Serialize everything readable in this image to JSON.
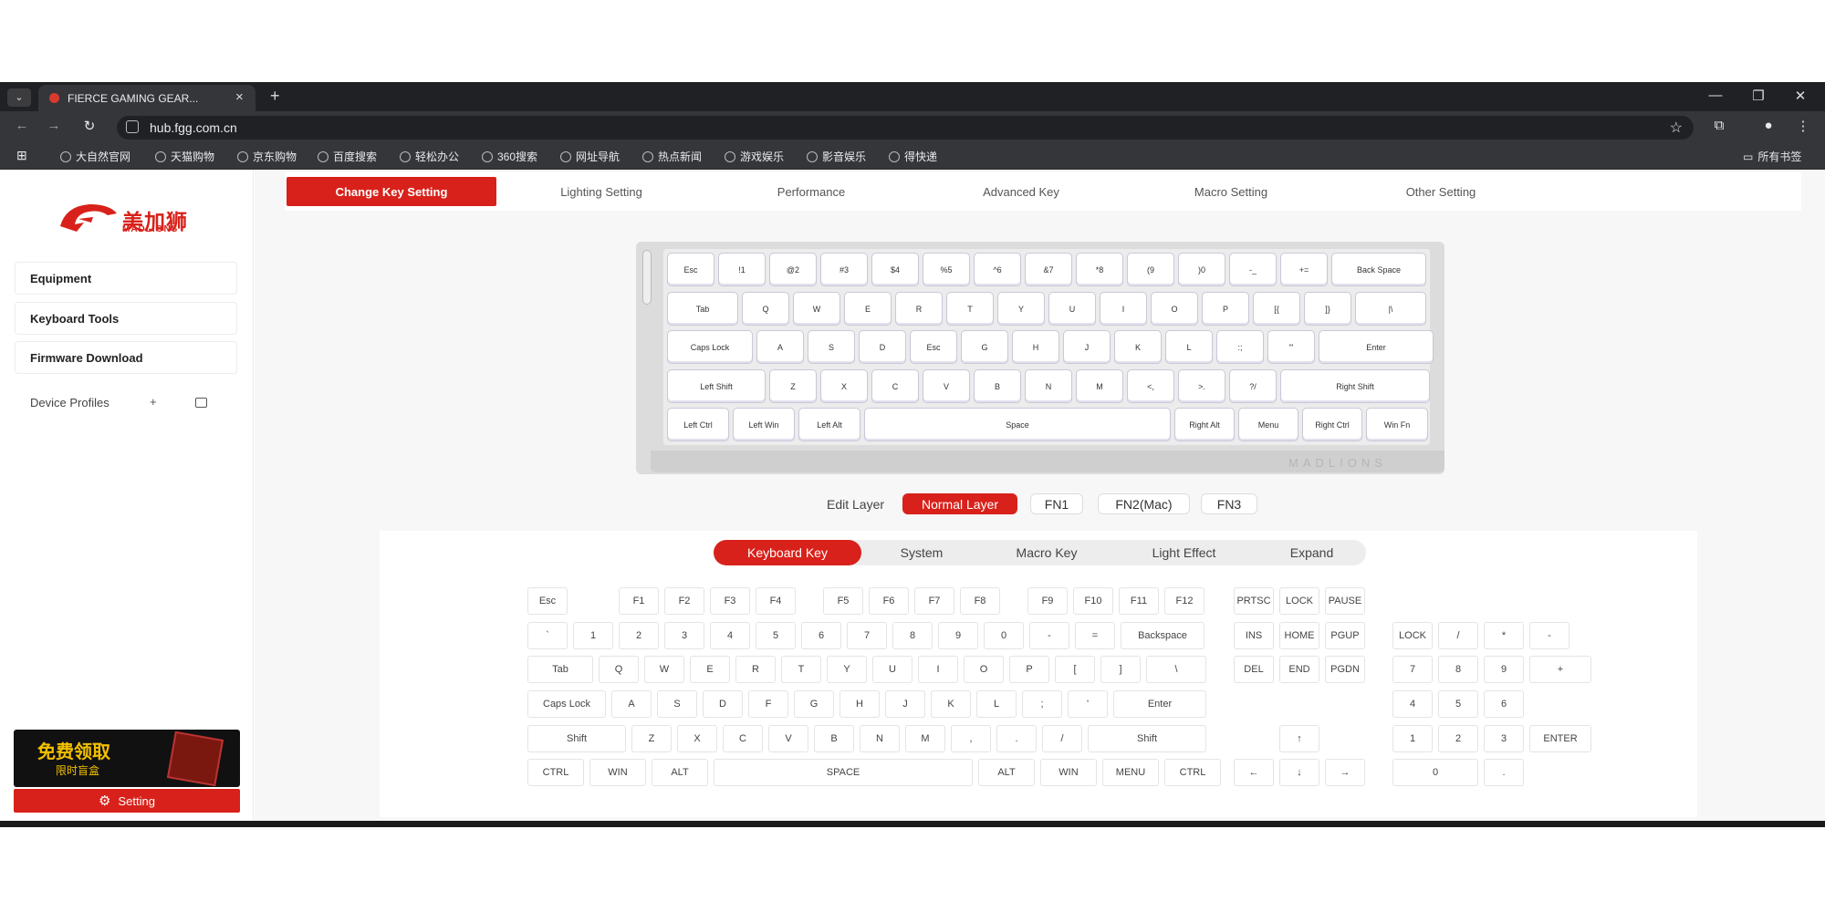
{
  "browser": {
    "tab_title": "FIERCE GAMING GEAR...",
    "url": "hub.fgg.com.cn",
    "bookmarks": [
      "大自然官网",
      "天猫购物",
      "京东购物",
      "百度搜索",
      "轻松办公",
      "360搜索",
      "网址导航",
      "热点新闻",
      "游戏娱乐",
      "影音娱乐",
      "得快递"
    ],
    "bookmark_folder": "所有书签"
  },
  "sidebar": {
    "logo_text": "美加狮",
    "logo_sub": "MADLIONS",
    "items": [
      "Equipment",
      "Keyboard Tools",
      "Firmware Download"
    ],
    "device_profiles": "Device Profiles",
    "plus": "+",
    "banner_line1": "免费领取",
    "banner_line2": "限时盲盒",
    "setting_label": "Setting"
  },
  "top_tabs": [
    "Change Key Setting",
    "Lighting Setting",
    "Performance",
    "Advanced Key",
    "Macro Setting",
    "Other Setting"
  ],
  "keyboard": {
    "brand": "MADLIONS",
    "rows": [
      [
        "Esc",
        "!1",
        "@2",
        "#3",
        "$4",
        "%5",
        "^6",
        "&7",
        "*8",
        "(9",
        ")0",
        "-_",
        "+=",
        "Back Space"
      ],
      [
        "Tab",
        "Q",
        "W",
        "E",
        "R",
        "T",
        "Y",
        "U",
        "I",
        "O",
        "P",
        "[{",
        "]}",
        "|\\"
      ],
      [
        "Caps Lock",
        "A",
        "S",
        "D",
        "Esc",
        "G",
        "H",
        "J",
        "K",
        "L",
        ":;",
        "\"'",
        "Enter"
      ],
      [
        "Left Shift",
        "Z",
        "X",
        "C",
        "V",
        "B",
        "N",
        "M",
        "<,",
        ">.",
        "?/",
        "Right Shift"
      ],
      [
        "Left Ctrl",
        "Left Win",
        "Left Alt",
        "Space",
        "Right Alt",
        "Menu",
        "Right Ctrl",
        "Win Fn"
      ]
    ]
  },
  "layers": {
    "label": "Edit Layer",
    "options": [
      "Normal Layer",
      "FN1",
      "FN2(Mac)",
      "FN3"
    ]
  },
  "key_tabs": [
    "Keyboard Key",
    "System",
    "Macro Key",
    "Light Effect",
    "Expand"
  ],
  "full_keyboard": {
    "fn_row": [
      "Esc",
      "F1",
      "F2",
      "F3",
      "F4",
      "F5",
      "F6",
      "F7",
      "F8",
      "F9",
      "F10",
      "F11",
      "F12"
    ],
    "num_row": [
      "`",
      "1",
      "2",
      "3",
      "4",
      "5",
      "6",
      "7",
      "8",
      "9",
      "0",
      "-",
      "=",
      "Backspace"
    ],
    "tab_row": [
      "Tab",
      "Q",
      "W",
      "E",
      "R",
      "T",
      "Y",
      "U",
      "I",
      "O",
      "P",
      "[",
      "]",
      "\\"
    ],
    "caps_row": [
      "Caps Lock",
      "A",
      "S",
      "D",
      "F",
      "G",
      "H",
      "J",
      "K",
      "L",
      ";",
      "'",
      "Enter"
    ],
    "shift_row": [
      "Shift",
      "Z",
      "X",
      "C",
      "V",
      "B",
      "N",
      "M",
      ",",
      ".",
      "/",
      "Shift"
    ],
    "ctrl_row": [
      "CTRL",
      "WIN",
      "ALT",
      "SPACE",
      "ALT",
      "WIN",
      "MENU",
      "CTRL"
    ],
    "nav_top": [
      "PRTSC",
      "LOCK",
      "PAUSE"
    ],
    "nav_mid": [
      "INS",
      "HOME",
      "PGUP"
    ],
    "nav_low": [
      "DEL",
      "END",
      "PGDN"
    ],
    "arrows": [
      "↑",
      "←",
      "↓",
      "→"
    ],
    "numpad": [
      "LOCK",
      "/",
      "*",
      "-",
      "7",
      "8",
      "9",
      "+",
      "4",
      "5",
      "6",
      "1",
      "2",
      "3",
      "ENTER",
      "0",
      "."
    ]
  }
}
